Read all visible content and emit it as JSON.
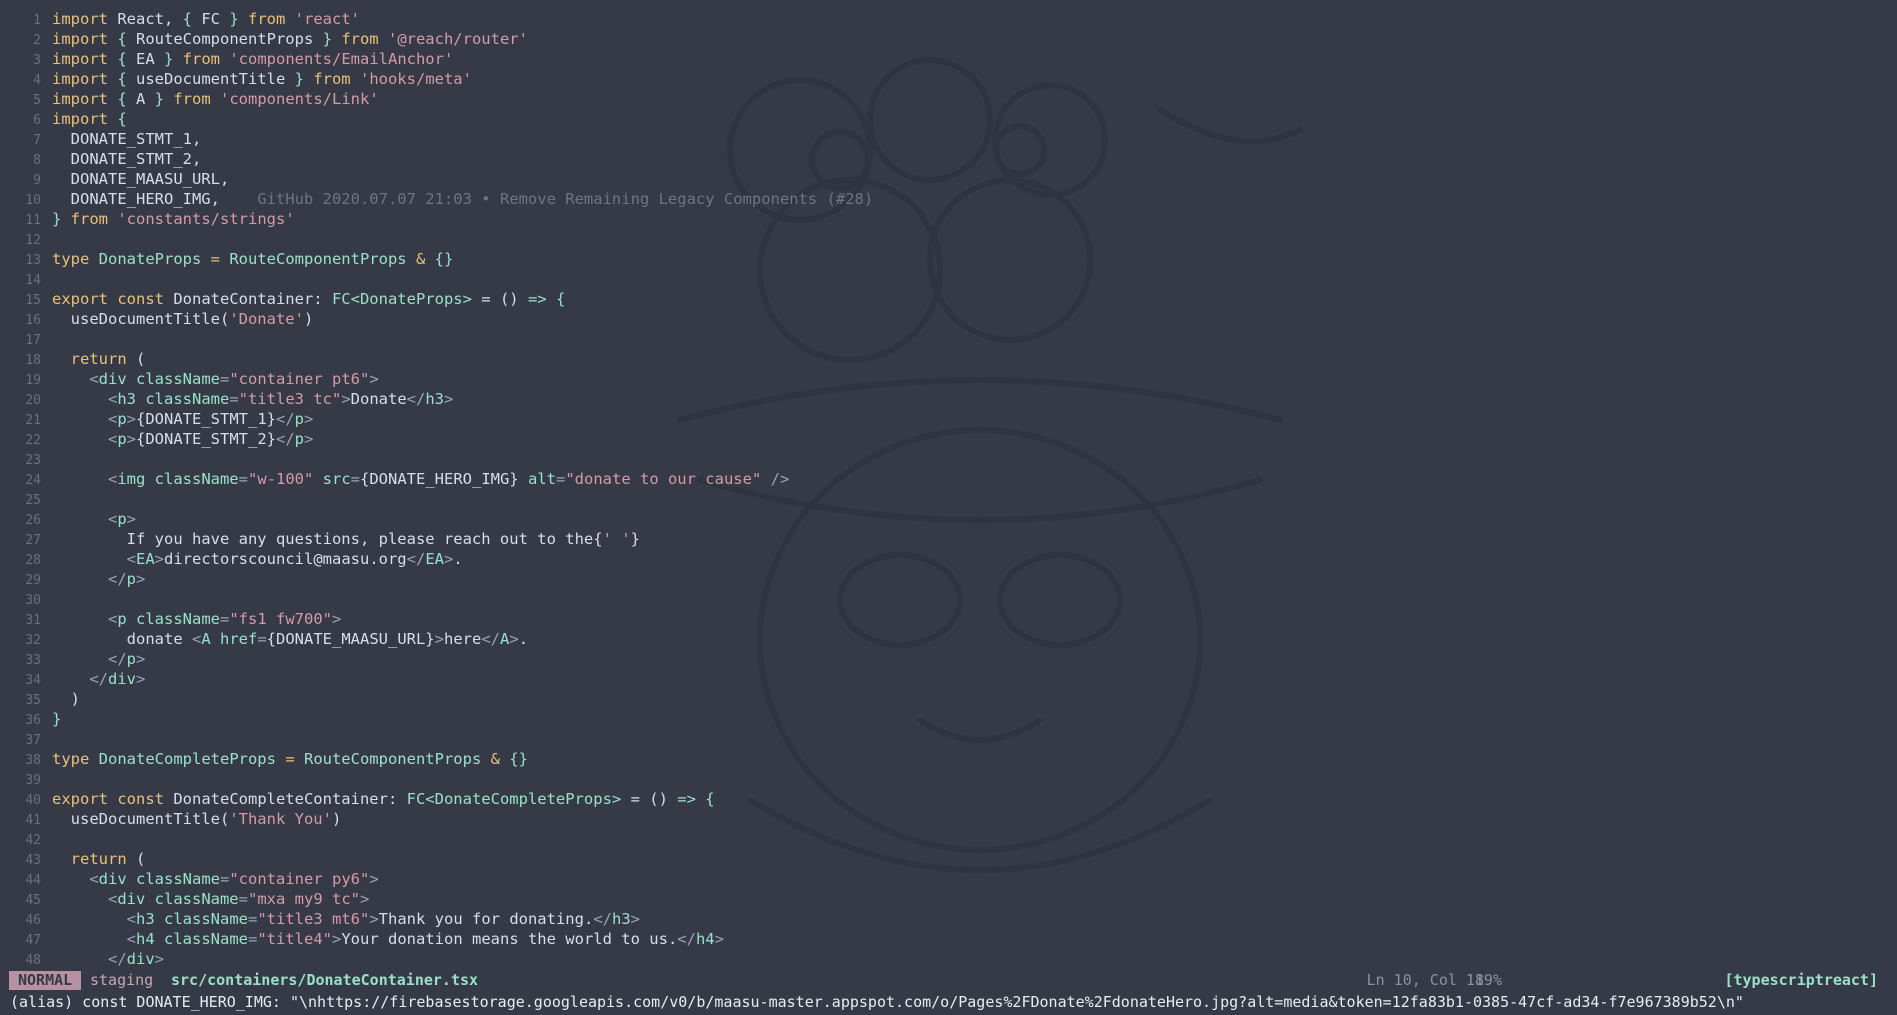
{
  "editor": {
    "lines": [
      {
        "n": "1",
        "tokens": [
          [
            "k",
            "import "
          ],
          [
            "d",
            "React, "
          ],
          [
            "g",
            "{ "
          ],
          [
            "d",
            "FC "
          ],
          [
            "g",
            "} "
          ],
          [
            "k",
            "from "
          ],
          [
            "s",
            "'react'"
          ]
        ]
      },
      {
        "n": "2",
        "tokens": [
          [
            "k",
            "import "
          ],
          [
            "g",
            "{ "
          ],
          [
            "d",
            "RouteComponentProps "
          ],
          [
            "g",
            "} "
          ],
          [
            "k",
            "from "
          ],
          [
            "s",
            "'@reach/router'"
          ]
        ]
      },
      {
        "n": "3",
        "tokens": [
          [
            "k",
            "import "
          ],
          [
            "g",
            "{ "
          ],
          [
            "d",
            "EA "
          ],
          [
            "g",
            "} "
          ],
          [
            "k",
            "from "
          ],
          [
            "s",
            "'components/EmailAnchor'"
          ]
        ]
      },
      {
        "n": "4",
        "tokens": [
          [
            "k",
            "import "
          ],
          [
            "g",
            "{ "
          ],
          [
            "d",
            "useDocumentTitle "
          ],
          [
            "g",
            "} "
          ],
          [
            "k",
            "from "
          ],
          [
            "s",
            "'hooks/meta'"
          ]
        ]
      },
      {
        "n": "5",
        "tokens": [
          [
            "k",
            "import "
          ],
          [
            "g",
            "{ "
          ],
          [
            "d",
            "A "
          ],
          [
            "g",
            "} "
          ],
          [
            "k",
            "from "
          ],
          [
            "s",
            "'components/Link'"
          ]
        ]
      },
      {
        "n": "6",
        "tokens": [
          [
            "k",
            "import "
          ],
          [
            "g",
            "{"
          ]
        ]
      },
      {
        "n": "7",
        "tokens": [
          [
            "d",
            "  DONATE_STMT_1,"
          ]
        ]
      },
      {
        "n": "8",
        "tokens": [
          [
            "d",
            "  DONATE_STMT_2,"
          ]
        ]
      },
      {
        "n": "9",
        "tokens": [
          [
            "d",
            "  DONATE_MAASU_URL,"
          ]
        ]
      },
      {
        "n": "10",
        "tokens": [
          [
            "d",
            "  DONATE_HERO_IMG,    "
          ],
          [
            "blame",
            "GitHub 2020.07.07 21:03 • Remove Remaining Legacy Components (#28)"
          ]
        ]
      },
      {
        "n": "11",
        "tokens": [
          [
            "g",
            "} "
          ],
          [
            "k",
            "from "
          ],
          [
            "s",
            "'constants/strings'"
          ]
        ]
      },
      {
        "n": "12",
        "tokens": []
      },
      {
        "n": "13",
        "tokens": [
          [
            "k",
            "type "
          ],
          [
            "g",
            "DonateProps "
          ],
          [
            "k",
            "= "
          ],
          [
            "g",
            "RouteComponentProps "
          ],
          [
            "k",
            "& "
          ],
          [
            "g",
            "{}"
          ]
        ]
      },
      {
        "n": "14",
        "tokens": []
      },
      {
        "n": "15",
        "tokens": [
          [
            "k",
            "export const "
          ],
          [
            "d",
            "DonateContainer: "
          ],
          [
            "g",
            "FC<DonateProps> "
          ],
          [
            "d",
            "= () "
          ],
          [
            "g",
            "=> {"
          ]
        ]
      },
      {
        "n": "16",
        "tokens": [
          [
            "d",
            "  useDocumentTitle("
          ],
          [
            "s",
            "'Donate'"
          ],
          [
            "d",
            ")"
          ]
        ]
      },
      {
        "n": "17",
        "tokens": []
      },
      {
        "n": "18",
        "tokens": [
          [
            "k",
            "  return "
          ],
          [
            "d",
            "("
          ]
        ]
      },
      {
        "n": "19",
        "tokens": [
          [
            "p",
            "    <"
          ],
          [
            "tg",
            "div "
          ],
          [
            "g",
            "className"
          ],
          [
            "p",
            "="
          ],
          [
            "s",
            "\"container pt6\""
          ],
          [
            "p",
            ">"
          ]
        ]
      },
      {
        "n": "20",
        "tokens": [
          [
            "p",
            "      <"
          ],
          [
            "tg",
            "h3 "
          ],
          [
            "g",
            "className"
          ],
          [
            "p",
            "="
          ],
          [
            "s",
            "\"title3 tc\""
          ],
          [
            "p",
            ">"
          ],
          [
            "d",
            "Donate"
          ],
          [
            "p",
            "</"
          ],
          [
            "tg",
            "h3"
          ],
          [
            "p",
            ">"
          ]
        ]
      },
      {
        "n": "21",
        "tokens": [
          [
            "p",
            "      <"
          ],
          [
            "tg",
            "p"
          ],
          [
            "p",
            ">"
          ],
          [
            "d",
            "{DONATE_STMT_1}"
          ],
          [
            "p",
            "</"
          ],
          [
            "tg",
            "p"
          ],
          [
            "p",
            ">"
          ]
        ]
      },
      {
        "n": "22",
        "tokens": [
          [
            "p",
            "      <"
          ],
          [
            "tg",
            "p"
          ],
          [
            "p",
            ">"
          ],
          [
            "d",
            "{DONATE_STMT_2}"
          ],
          [
            "p",
            "</"
          ],
          [
            "tg",
            "p"
          ],
          [
            "p",
            ">"
          ]
        ]
      },
      {
        "n": "23",
        "tokens": []
      },
      {
        "n": "24",
        "tokens": [
          [
            "p",
            "      <"
          ],
          [
            "tg",
            "img "
          ],
          [
            "g",
            "className"
          ],
          [
            "p",
            "="
          ],
          [
            "s",
            "\"w-100\" "
          ],
          [
            "g",
            "src"
          ],
          [
            "p",
            "="
          ],
          [
            "d",
            "{DONATE_HERO_IMG} "
          ],
          [
            "g",
            "alt"
          ],
          [
            "p",
            "="
          ],
          [
            "s",
            "\"donate to our cause\" "
          ],
          [
            "p",
            "/>"
          ]
        ]
      },
      {
        "n": "25",
        "tokens": []
      },
      {
        "n": "26",
        "tokens": [
          [
            "p",
            "      <"
          ],
          [
            "tg",
            "p"
          ],
          [
            "p",
            ">"
          ]
        ]
      },
      {
        "n": "27",
        "tokens": [
          [
            "d",
            "        If you have any questions, please reach out to the{"
          ],
          [
            "s",
            "' '"
          ],
          [
            "d",
            "}"
          ]
        ]
      },
      {
        "n": "28",
        "tokens": [
          [
            "p",
            "        <"
          ],
          [
            "tg",
            "EA"
          ],
          [
            "p",
            ">"
          ],
          [
            "d",
            "directorscouncil@maasu.org"
          ],
          [
            "p",
            "</"
          ],
          [
            "tg",
            "EA"
          ],
          [
            "p",
            ">"
          ],
          [
            "d",
            "."
          ]
        ]
      },
      {
        "n": "29",
        "tokens": [
          [
            "p",
            "      </"
          ],
          [
            "tg",
            "p"
          ],
          [
            "p",
            ">"
          ]
        ]
      },
      {
        "n": "30",
        "tokens": []
      },
      {
        "n": "31",
        "tokens": [
          [
            "p",
            "      <"
          ],
          [
            "tg",
            "p "
          ],
          [
            "g",
            "className"
          ],
          [
            "p",
            "="
          ],
          [
            "s",
            "\"fs1 fw700\""
          ],
          [
            "p",
            ">"
          ]
        ]
      },
      {
        "n": "32",
        "tokens": [
          [
            "d",
            "        donate "
          ],
          [
            "p",
            "<"
          ],
          [
            "tg",
            "A "
          ],
          [
            "g",
            "href"
          ],
          [
            "p",
            "="
          ],
          [
            "d",
            "{DONATE_MAASU_URL}"
          ],
          [
            "p",
            ">"
          ],
          [
            "d",
            "here"
          ],
          [
            "p",
            "</"
          ],
          [
            "tg",
            "A"
          ],
          [
            "p",
            ">"
          ],
          [
            "d",
            "."
          ]
        ]
      },
      {
        "n": "33",
        "tokens": [
          [
            "p",
            "      </"
          ],
          [
            "tg",
            "p"
          ],
          [
            "p",
            ">"
          ]
        ]
      },
      {
        "n": "34",
        "tokens": [
          [
            "p",
            "    </"
          ],
          [
            "tg",
            "div"
          ],
          [
            "p",
            ">"
          ]
        ]
      },
      {
        "n": "35",
        "tokens": [
          [
            "d",
            "  )"
          ]
        ]
      },
      {
        "n": "36",
        "tokens": [
          [
            "g",
            "}"
          ]
        ]
      },
      {
        "n": "37",
        "tokens": []
      },
      {
        "n": "38",
        "tokens": [
          [
            "k",
            "type "
          ],
          [
            "g",
            "DonateCompleteProps "
          ],
          [
            "k",
            "= "
          ],
          [
            "g",
            "RouteComponentProps "
          ],
          [
            "k",
            "& "
          ],
          [
            "g",
            "{}"
          ]
        ]
      },
      {
        "n": "39",
        "tokens": []
      },
      {
        "n": "40",
        "tokens": [
          [
            "k",
            "export const "
          ],
          [
            "d",
            "DonateCompleteContainer: "
          ],
          [
            "g",
            "FC<DonateCompleteProps> "
          ],
          [
            "d",
            "= () "
          ],
          [
            "g",
            "=> {"
          ]
        ]
      },
      {
        "n": "41",
        "tokens": [
          [
            "d",
            "  useDocumentTitle("
          ],
          [
            "s",
            "'Thank You'"
          ],
          [
            "d",
            ")"
          ]
        ]
      },
      {
        "n": "42",
        "tokens": []
      },
      {
        "n": "43",
        "tokens": [
          [
            "k",
            "  return "
          ],
          [
            "d",
            "("
          ]
        ]
      },
      {
        "n": "44",
        "tokens": [
          [
            "p",
            "    <"
          ],
          [
            "tg",
            "div "
          ],
          [
            "g",
            "className"
          ],
          [
            "p",
            "="
          ],
          [
            "s",
            "\"container py6\""
          ],
          [
            "p",
            ">"
          ]
        ]
      },
      {
        "n": "45",
        "tokens": [
          [
            "p",
            "      <"
          ],
          [
            "tg",
            "div "
          ],
          [
            "g",
            "className"
          ],
          [
            "p",
            "="
          ],
          [
            "s",
            "\"mxa my9 tc\""
          ],
          [
            "p",
            ">"
          ]
        ]
      },
      {
        "n": "46",
        "tokens": [
          [
            "p",
            "        <"
          ],
          [
            "tg",
            "h3 "
          ],
          [
            "g",
            "className"
          ],
          [
            "p",
            "="
          ],
          [
            "s",
            "\"title3 mt6\""
          ],
          [
            "p",
            ">"
          ],
          [
            "d",
            "Thank you for donating."
          ],
          [
            "p",
            "</"
          ],
          [
            "tg",
            "h3"
          ],
          [
            "p",
            ">"
          ]
        ]
      },
      {
        "n": "47",
        "tokens": [
          [
            "p",
            "        <"
          ],
          [
            "tg",
            "h4 "
          ],
          [
            "g",
            "className"
          ],
          [
            "p",
            "="
          ],
          [
            "s",
            "\"title4\""
          ],
          [
            "p",
            ">"
          ],
          [
            "d",
            "Your donation means the world to us."
          ],
          [
            "p",
            "</"
          ],
          [
            "tg",
            "h4"
          ],
          [
            "p",
            ">"
          ]
        ]
      },
      {
        "n": "48",
        "tokens": [
          [
            "p",
            "      </"
          ],
          [
            "tg",
            "div"
          ],
          [
            "p",
            ">"
          ]
        ]
      }
    ]
  },
  "statusline": {
    "mode": "NORMAL",
    "branch": "staging",
    "file": "src/containers/DonateContainer.tsx",
    "position": "Ln 10, Col 18",
    "percent": "19%",
    "filetype": "[typescriptreact]"
  },
  "cmdline": {
    "text": "(alias) const DONATE_HERO_IMG: \"\\nhttps://firebasestorage.googleapis.com/v0/b/maasu-master.appspot.com/o/Pages%2FDonate%2FdonateHero.jpg?alt=media&token=12fa83b1-0385-47cf-ad34-f7e967389b52\\n\""
  },
  "colors": {
    "background": "#363a47",
    "keyword": "#e8c07a",
    "string": "#d39aa8",
    "type_tag": "#99e0c8",
    "mode_badge": "#b890a4"
  }
}
